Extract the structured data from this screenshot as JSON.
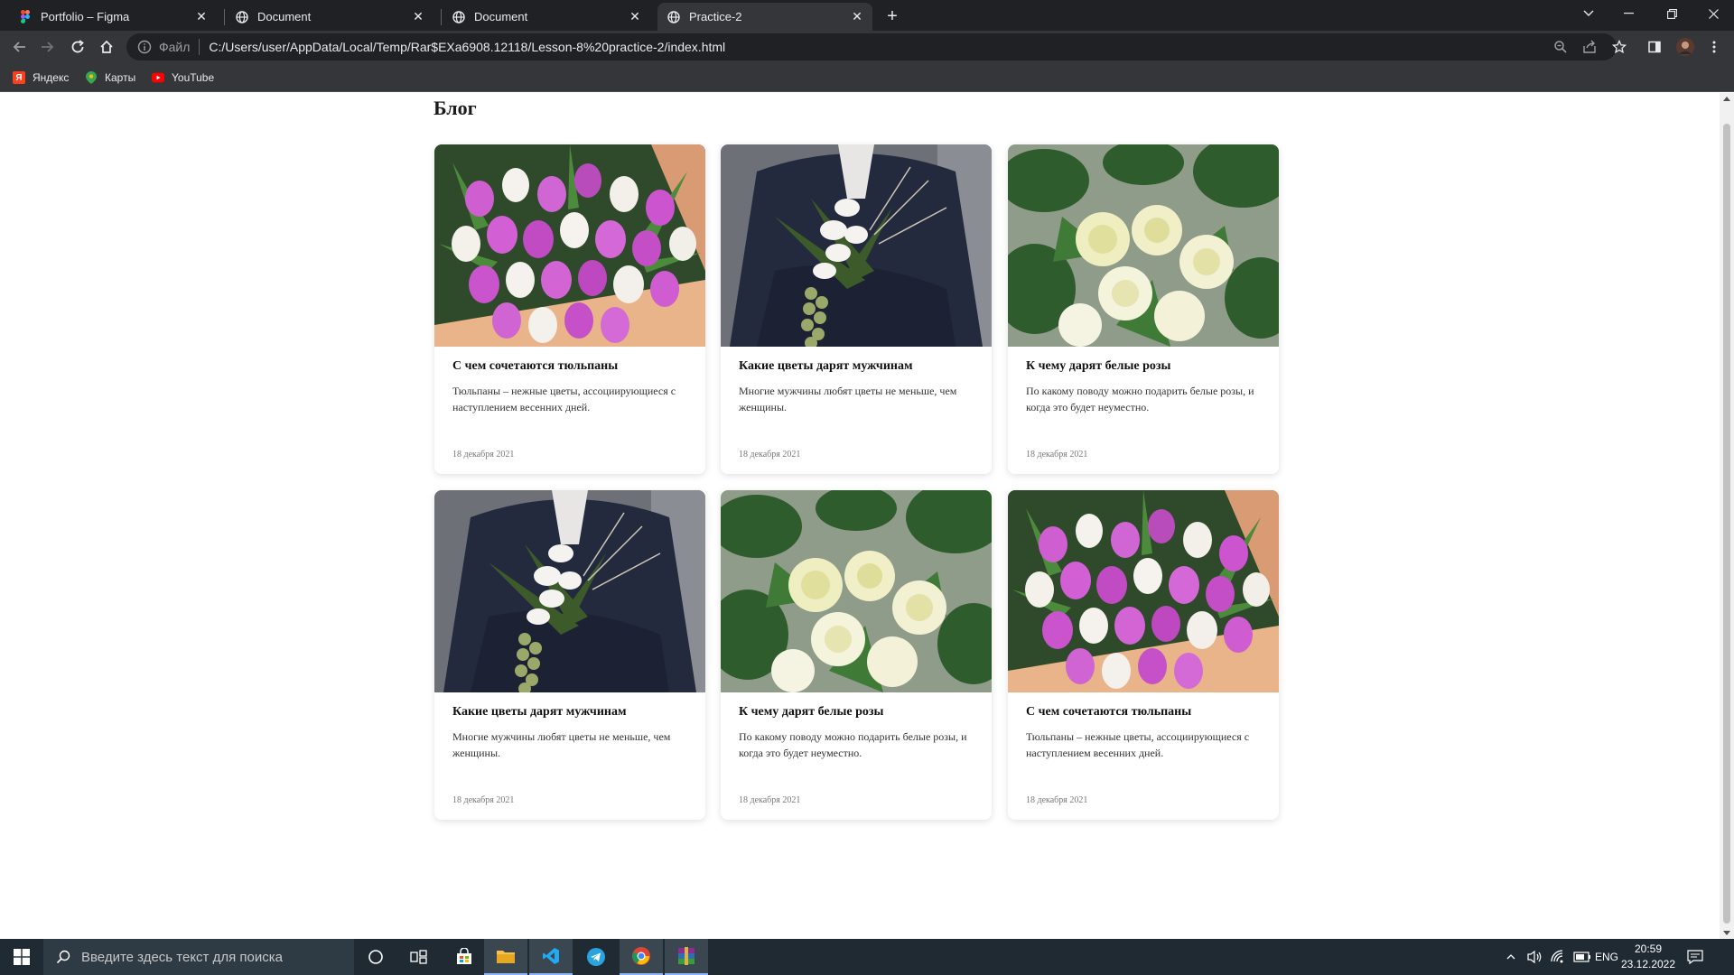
{
  "browser": {
    "tabs": [
      {
        "title": "Portfolio – Figma",
        "icon": "figma-icon",
        "active": false
      },
      {
        "title": "Document",
        "icon": "globe-icon",
        "active": false
      },
      {
        "title": "Document",
        "icon": "globe-icon",
        "active": false
      },
      {
        "title": "Practice-2",
        "icon": "globe-icon",
        "active": true
      }
    ],
    "address": {
      "scheme_label": "Файл",
      "url": "C:/Users/user/AppData/Local/Temp/Rar$EXa6908.12118/Lesson-8%20practice-2/index.html"
    },
    "bookmarks": [
      {
        "label": "Яндекс",
        "icon": "yandex-icon"
      },
      {
        "label": "Карты",
        "icon": "maps-icon"
      },
      {
        "label": "YouTube",
        "icon": "youtube-icon"
      }
    ]
  },
  "page": {
    "title": "Блог",
    "cards": [
      {
        "title": "С чем сочетаются тюльпаны",
        "text": "Тюльпаны – нежные цветы, ассоциирующиеся с наступлением весенних дней.",
        "date": "18 декабря 2021",
        "image": "tulips-photo"
      },
      {
        "title": "Какие цветы дарят мужчинам",
        "text": "Многие мужчины любят цветы не меньше, чем женщины.",
        "date": "18 декабря 2021",
        "image": "man-bouquet-photo"
      },
      {
        "title": "К чему дарят белые розы",
        "text": "По какому поводу можно подарить белые розы, и когда это будет неуместно.",
        "date": "18 декабря 2021",
        "image": "white-roses-photo"
      },
      {
        "title": "Какие цветы дарят мужчинам",
        "text": "Многие мужчины любят цветы не меньше, чем женщины.",
        "date": "18 декабря 2021",
        "image": "man-bouquet-photo"
      },
      {
        "title": "К чему дарят белые розы",
        "text": "По какому поводу можно подарить белые розы, и когда это будет неуместно.",
        "date": "18 декабря 2021",
        "image": "white-roses-photo"
      },
      {
        "title": "С чем сочетаются тюльпаны",
        "text": "Тюльпаны – нежные цветы, ассоциирующиеся с наступлением весенних дней.",
        "date": "18 декабря 2021",
        "image": "tulips-photo"
      }
    ]
  },
  "taskbar": {
    "search_placeholder": "Введите здесь текст для поиска",
    "language": "ENG",
    "time": "20:59",
    "date": "23.12.2022"
  }
}
